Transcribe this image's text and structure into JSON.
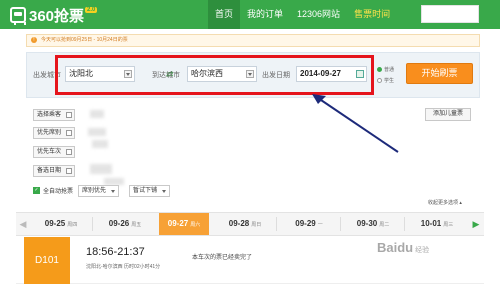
{
  "header": {
    "logo_text": "360抢票",
    "logo_badge": "2.0",
    "nav": [
      "首页",
      "我的订单",
      "12306网站",
      "售票时间"
    ]
  },
  "notice": "今天可以抢到09月25日 - 10月24日的票",
  "search": {
    "from_label": "出发城市",
    "from_value": "沈阳北",
    "to_label": "到达城市",
    "to_value": "哈尔滨西",
    "date_label": "出发日期",
    "date_value": "2014-09-27",
    "radio_normal": "普通",
    "radio_student": "学生",
    "start_button": "开始刷票"
  },
  "filters": {
    "items": [
      "选择乘客",
      "优先席别",
      "优先车次",
      "备选日期"
    ],
    "add_child": "添加儿童票",
    "auto_label": "全自动抢票",
    "select1": "席别优先",
    "select2": "暂试下铺",
    "more": "收起更多选项"
  },
  "dates": [
    {
      "date": "09-25",
      "weekday": "周四"
    },
    {
      "date": "09-26",
      "weekday": "周五"
    },
    {
      "date": "09-27",
      "weekday": "周六"
    },
    {
      "date": "09-28",
      "weekday": "周日"
    },
    {
      "date": "09-29",
      "weekday": "一"
    },
    {
      "date": "09-30",
      "weekday": "周二"
    },
    {
      "date": "10-01",
      "weekday": "周三"
    }
  ],
  "train": {
    "code": "D101",
    "time": "18:56-21:37",
    "route": "沈阳北-哈尔滨西 历时02小时41分",
    "note": "本车次的票已经卖完了"
  },
  "watermark": {
    "brand": "Baidu",
    "suffix": "经验"
  },
  "colors": {
    "brand_green": "#39a94a",
    "accent_orange": "#f98e1d",
    "highlight_red": "#e5141c"
  }
}
